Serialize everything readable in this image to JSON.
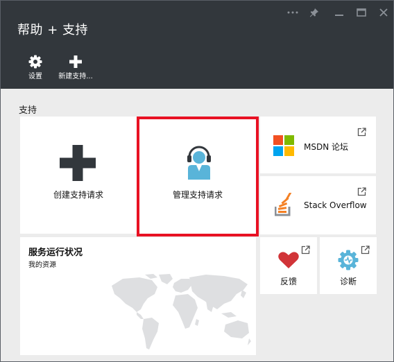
{
  "header": {
    "title": "帮助 + 支持",
    "window_controls": {
      "more": "ellipsis-icon",
      "pin": "pin-icon",
      "minimize": "minimize-icon",
      "maximize": "maximize-icon",
      "close": "close-icon"
    },
    "commands": [
      {
        "label": "设置",
        "icon": "gear-icon"
      },
      {
        "label": "新建支持...",
        "icon": "plus-icon"
      }
    ]
  },
  "section": {
    "label": "支持"
  },
  "tiles": {
    "create_request": {
      "label": "创建支持请求",
      "icon": "plus-icon"
    },
    "manage_requests": {
      "label": "管理支持请求",
      "icon": "support-person-icon",
      "highlight_color": "#e81123"
    },
    "msdn": {
      "label": "MSDN 论坛",
      "icon": "microsoft-logo-icon"
    },
    "stack_overflow": {
      "label": "Stack Overflow",
      "icon": "stack-overflow-icon"
    },
    "service_health": {
      "title": "服务运行状况",
      "subtitle": "我的资源",
      "icon": "world-map-icon"
    },
    "feedback": {
      "label": "反馈",
      "icon": "heart-icon"
    },
    "diagnostics": {
      "label": "诊断",
      "icon": "gear-icon"
    }
  },
  "colors": {
    "header_bg": "#32373c",
    "background": "#ececec",
    "accent_blue": "#59b4d9",
    "heart_red": "#d13438",
    "highlight_red": "#e81123"
  }
}
